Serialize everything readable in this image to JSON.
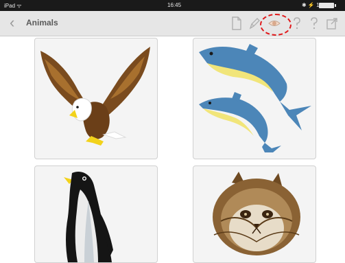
{
  "status_bar": {
    "carrier": "iPad ᯤ",
    "time": "16:45",
    "battery": "✱ ⚡ 15%"
  },
  "nav": {
    "title": "Animals",
    "back_icon": "chevron-left-icon"
  },
  "toolbar": [
    "document-icon",
    "pencil-icon",
    "eye-icon",
    "help-icon",
    "help-icon",
    "share-icon"
  ],
  "highlight": {
    "target": "eye-icon",
    "color": "#e0191b"
  },
  "tiles": [
    {
      "animal": "eagle"
    },
    {
      "animal": "dolphins"
    },
    {
      "animal": "penguin"
    },
    {
      "animal": "cat"
    }
  ]
}
